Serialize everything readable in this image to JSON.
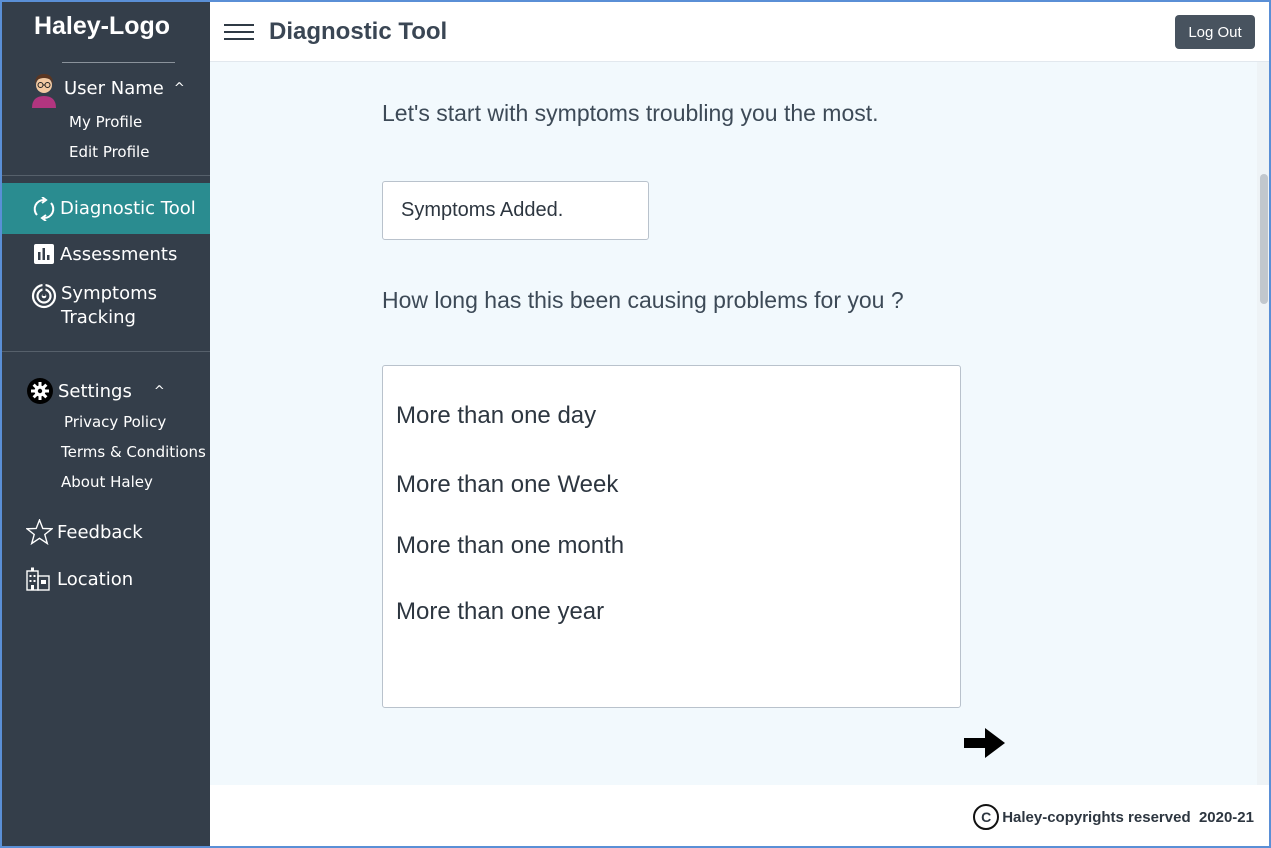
{
  "sidebar": {
    "logo": "Haley-Logo",
    "user": {
      "name": "User Name",
      "caret": "^",
      "items": [
        "My Profile",
        "Edit Profile"
      ]
    },
    "nav": [
      {
        "label": "Diagnostic Tool",
        "icon": "refresh-icon",
        "active": true
      },
      {
        "label": "Assessments",
        "icon": "bar-chart-icon"
      },
      {
        "label_line1": "Symptoms",
        "label_line2": "Tracking",
        "icon": "target-icon"
      }
    ],
    "settings": {
      "label": "Settings",
      "caret": "^",
      "items": [
        "Privacy Policy",
        "Terms & Conditions",
        "About Haley"
      ]
    },
    "feedback": {
      "label": "Feedback",
      "icon": "star-icon"
    },
    "location": {
      "label": "Location",
      "icon": "building-icon"
    }
  },
  "header": {
    "title": "Diagnostic Tool",
    "logout_label": "Log Out"
  },
  "main": {
    "question1": "Let's start with symptoms troubling you the most.",
    "symptoms_value": "Symptoms Added.",
    "question2": "How long has this been causing problems for you ?",
    "options": [
      "More than one day",
      "More than one Week",
      "More than one month",
      "More than one year"
    ]
  },
  "footer": {
    "copyright_symbol": "C",
    "copyright_text": "Haley-copyrights reserved  2020-21"
  },
  "colors": {
    "sidebar_bg": "#343e4a",
    "active_bg": "#2a8c90",
    "main_bg": "#f2f9fd",
    "logout_bg": "#48535f"
  }
}
